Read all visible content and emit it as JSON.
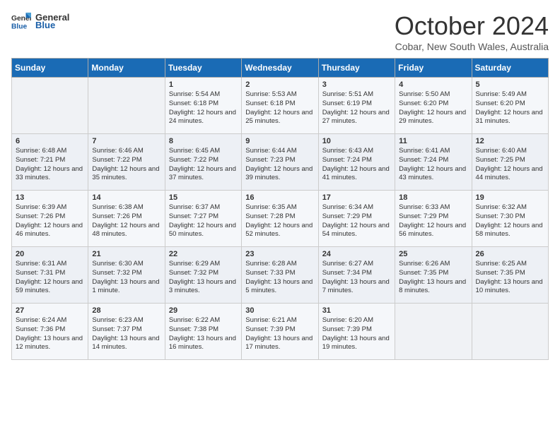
{
  "header": {
    "logo_general": "General",
    "logo_blue": "Blue",
    "month": "October 2024",
    "location": "Cobar, New South Wales, Australia"
  },
  "days_of_week": [
    "Sunday",
    "Monday",
    "Tuesday",
    "Wednesday",
    "Thursday",
    "Friday",
    "Saturday"
  ],
  "weeks": [
    [
      {
        "day": "",
        "content": ""
      },
      {
        "day": "",
        "content": ""
      },
      {
        "day": "1",
        "content": "Sunrise: 5:54 AM\nSunset: 6:18 PM\nDaylight: 12 hours and 24 minutes."
      },
      {
        "day": "2",
        "content": "Sunrise: 5:53 AM\nSunset: 6:18 PM\nDaylight: 12 hours and 25 minutes."
      },
      {
        "day": "3",
        "content": "Sunrise: 5:51 AM\nSunset: 6:19 PM\nDaylight: 12 hours and 27 minutes."
      },
      {
        "day": "4",
        "content": "Sunrise: 5:50 AM\nSunset: 6:20 PM\nDaylight: 12 hours and 29 minutes."
      },
      {
        "day": "5",
        "content": "Sunrise: 5:49 AM\nSunset: 6:20 PM\nDaylight: 12 hours and 31 minutes."
      }
    ],
    [
      {
        "day": "6",
        "content": "Sunrise: 6:48 AM\nSunset: 7:21 PM\nDaylight: 12 hours and 33 minutes."
      },
      {
        "day": "7",
        "content": "Sunrise: 6:46 AM\nSunset: 7:22 PM\nDaylight: 12 hours and 35 minutes."
      },
      {
        "day": "8",
        "content": "Sunrise: 6:45 AM\nSunset: 7:22 PM\nDaylight: 12 hours and 37 minutes."
      },
      {
        "day": "9",
        "content": "Sunrise: 6:44 AM\nSunset: 7:23 PM\nDaylight: 12 hours and 39 minutes."
      },
      {
        "day": "10",
        "content": "Sunrise: 6:43 AM\nSunset: 7:24 PM\nDaylight: 12 hours and 41 minutes."
      },
      {
        "day": "11",
        "content": "Sunrise: 6:41 AM\nSunset: 7:24 PM\nDaylight: 12 hours and 43 minutes."
      },
      {
        "day": "12",
        "content": "Sunrise: 6:40 AM\nSunset: 7:25 PM\nDaylight: 12 hours and 44 minutes."
      }
    ],
    [
      {
        "day": "13",
        "content": "Sunrise: 6:39 AM\nSunset: 7:26 PM\nDaylight: 12 hours and 46 minutes."
      },
      {
        "day": "14",
        "content": "Sunrise: 6:38 AM\nSunset: 7:26 PM\nDaylight: 12 hours and 48 minutes."
      },
      {
        "day": "15",
        "content": "Sunrise: 6:37 AM\nSunset: 7:27 PM\nDaylight: 12 hours and 50 minutes."
      },
      {
        "day": "16",
        "content": "Sunrise: 6:35 AM\nSunset: 7:28 PM\nDaylight: 12 hours and 52 minutes."
      },
      {
        "day": "17",
        "content": "Sunrise: 6:34 AM\nSunset: 7:29 PM\nDaylight: 12 hours and 54 minutes."
      },
      {
        "day": "18",
        "content": "Sunrise: 6:33 AM\nSunset: 7:29 PM\nDaylight: 12 hours and 56 minutes."
      },
      {
        "day": "19",
        "content": "Sunrise: 6:32 AM\nSunset: 7:30 PM\nDaylight: 12 hours and 58 minutes."
      }
    ],
    [
      {
        "day": "20",
        "content": "Sunrise: 6:31 AM\nSunset: 7:31 PM\nDaylight: 12 hours and 59 minutes."
      },
      {
        "day": "21",
        "content": "Sunrise: 6:30 AM\nSunset: 7:32 PM\nDaylight: 13 hours and 1 minute."
      },
      {
        "day": "22",
        "content": "Sunrise: 6:29 AM\nSunset: 7:32 PM\nDaylight: 13 hours and 3 minutes."
      },
      {
        "day": "23",
        "content": "Sunrise: 6:28 AM\nSunset: 7:33 PM\nDaylight: 13 hours and 5 minutes."
      },
      {
        "day": "24",
        "content": "Sunrise: 6:27 AM\nSunset: 7:34 PM\nDaylight: 13 hours and 7 minutes."
      },
      {
        "day": "25",
        "content": "Sunrise: 6:26 AM\nSunset: 7:35 PM\nDaylight: 13 hours and 8 minutes."
      },
      {
        "day": "26",
        "content": "Sunrise: 6:25 AM\nSunset: 7:35 PM\nDaylight: 13 hours and 10 minutes."
      }
    ],
    [
      {
        "day": "27",
        "content": "Sunrise: 6:24 AM\nSunset: 7:36 PM\nDaylight: 13 hours and 12 minutes."
      },
      {
        "day": "28",
        "content": "Sunrise: 6:23 AM\nSunset: 7:37 PM\nDaylight: 13 hours and 14 minutes."
      },
      {
        "day": "29",
        "content": "Sunrise: 6:22 AM\nSunset: 7:38 PM\nDaylight: 13 hours and 16 minutes."
      },
      {
        "day": "30",
        "content": "Sunrise: 6:21 AM\nSunset: 7:39 PM\nDaylight: 13 hours and 17 minutes."
      },
      {
        "day": "31",
        "content": "Sunrise: 6:20 AM\nSunset: 7:39 PM\nDaylight: 13 hours and 19 minutes."
      },
      {
        "day": "",
        "content": ""
      },
      {
        "day": "",
        "content": ""
      }
    ]
  ]
}
